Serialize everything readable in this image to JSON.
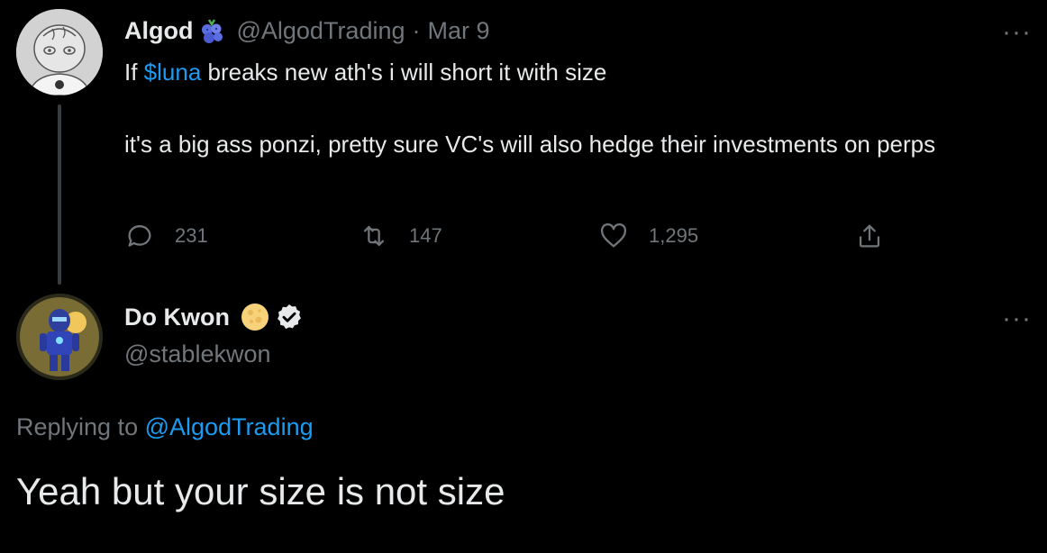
{
  "tweet": {
    "author_name": "Algod",
    "author_handle": "@AlgodTrading",
    "separator": "·",
    "date": "Mar 9",
    "text_prefix": "If ",
    "cashtag": "$luna",
    "text_suffix": " breaks new ath's i will short it with size",
    "text_line2": "it's a big ass ponzi, pretty sure VC's will also hedge their investments on perps",
    "more_label": "···",
    "stats": {
      "replies": "231",
      "retweets": "147",
      "likes": "1,295"
    },
    "icons": {
      "badge": "blueberry-icon",
      "reply": "reply-icon",
      "retweet": "retweet-icon",
      "like": "heart-icon",
      "share": "share-icon"
    }
  },
  "reply": {
    "author_name": "Do Kwon",
    "author_handle": "@stablekwon",
    "more_label": "···",
    "replying_prefix": "Replying to ",
    "replying_to": "@AlgodTrading",
    "text": "Yeah but your size is not size",
    "icons": {
      "badge": "moon-icon",
      "verified": "verified-badge-icon"
    }
  },
  "colors": {
    "background": "#000000",
    "primary_text": "#e7e9ea",
    "secondary_text": "#71767b",
    "link": "#1d9bf0"
  }
}
